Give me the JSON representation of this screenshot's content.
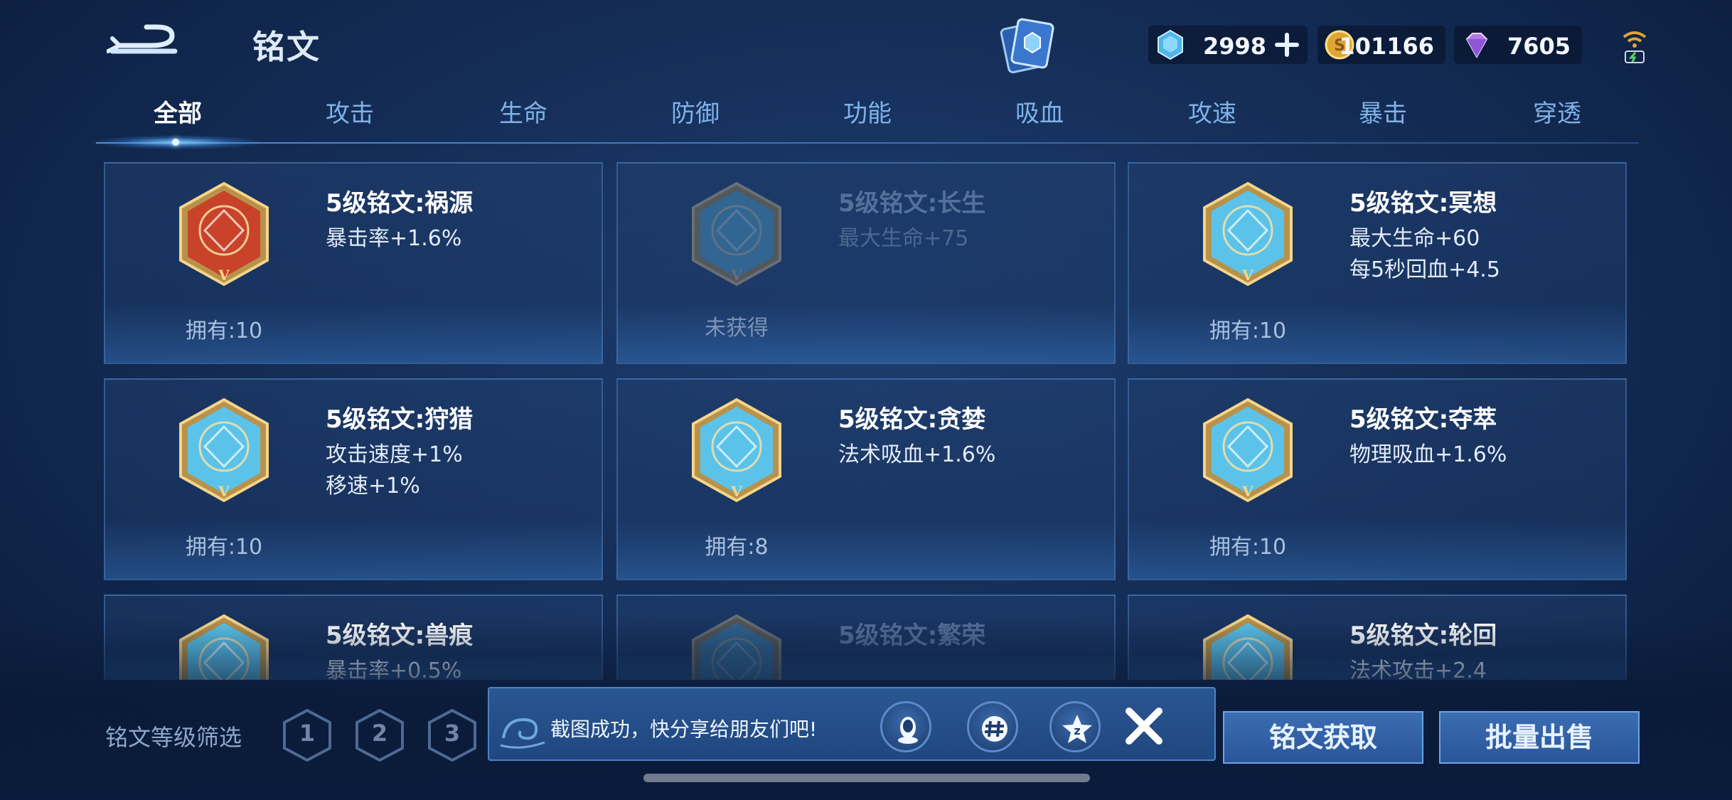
{
  "header": {
    "title": "铭文",
    "currencies": [
      {
        "name": "gem",
        "value": "2998"
      },
      {
        "name": "coin",
        "value": "101166"
      },
      {
        "name": "diamond",
        "value": "7605"
      }
    ]
  },
  "tabs": [
    {
      "label": "全部",
      "active": true
    },
    {
      "label": "攻击"
    },
    {
      "label": "生命"
    },
    {
      "label": "防御"
    },
    {
      "label": "功能"
    },
    {
      "label": "吸血"
    },
    {
      "label": "攻速"
    },
    {
      "label": "暴击"
    },
    {
      "label": "穿透"
    }
  ],
  "cards": [
    {
      "title": "5级铭文:祸源",
      "desc": [
        "暴击率+1.6%"
      ],
      "owned": "拥有:10",
      "color": "#c8432a",
      "locked": false
    },
    {
      "title": "5级铭文:长生",
      "desc": [
        "最大生命+75"
      ],
      "owned": "未获得",
      "color": "#5bb8e0",
      "locked": true
    },
    {
      "title": "5级铭文:冥想",
      "desc": [
        "最大生命+60",
        "每5秒回血+4.5"
      ],
      "owned": "拥有:10",
      "color": "#5bc3ea",
      "locked": false
    },
    {
      "title": "5级铭文:狩猎",
      "desc": [
        "攻击速度+1%",
        "移速+1%"
      ],
      "owned": "拥有:10",
      "color": "#5bc3ea",
      "locked": false
    },
    {
      "title": "5级铭文:贪婪",
      "desc": [
        "法术吸血+1.6%"
      ],
      "owned": "拥有:8",
      "color": "#5bc3ea",
      "locked": false
    },
    {
      "title": "5级铭文:夺萃",
      "desc": [
        "物理吸血+1.6%"
      ],
      "owned": "拥有:10",
      "color": "#5bc3ea",
      "locked": false
    },
    {
      "title": "5级铭文:兽痕",
      "desc": [
        "暴击率+0.5%"
      ],
      "owned": "",
      "color": "#5bc3ea",
      "locked": false
    },
    {
      "title": "5级铭文:繁荣",
      "desc": [
        ""
      ],
      "owned": "",
      "color": "#5bb8e0",
      "locked": true
    },
    {
      "title": "5级铭文:轮回",
      "desc": [
        "法术攻击+2.4"
      ],
      "owned": "",
      "color": "#5bc3ea",
      "locked": false
    }
  ],
  "filter": {
    "label": "铭文等级筛选",
    "levels": [
      "1",
      "2",
      "3"
    ]
  },
  "toast": {
    "text": "截图成功，快分享给朋友们吧!"
  },
  "buttons": {
    "obtain": "铭文获取",
    "sell": "批量出售"
  }
}
